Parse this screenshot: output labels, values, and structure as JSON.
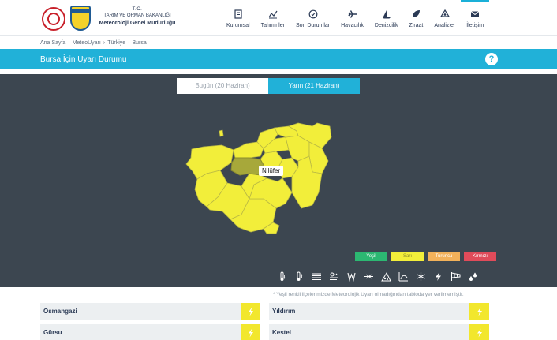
{
  "header": {
    "org_line1": "T.C.",
    "org_line2": "TARIM VE ORMAN BAKANLIĞI",
    "org_line3": "Meteoroloji Genel Müdürlüğü",
    "nav": [
      {
        "label": "Kurumsal",
        "icon": "building-icon"
      },
      {
        "label": "Tahminler",
        "icon": "chart-icon"
      },
      {
        "label": "Son Durumlar",
        "icon": "clock-icon"
      },
      {
        "label": "Havacılık",
        "icon": "plane-icon"
      },
      {
        "label": "Denizcilik",
        "icon": "sailboat-icon"
      },
      {
        "label": "Ziraat",
        "icon": "leaf-icon"
      },
      {
        "label": "Analizler",
        "icon": "analysis-icon"
      },
      {
        "label": "İletişim",
        "icon": "mail-icon"
      }
    ]
  },
  "breadcrumb": [
    "Ana Sayfa",
    "·",
    "MeteoUyarı",
    "›",
    "Türkiye",
    "·",
    "Bursa"
  ],
  "page": {
    "title": "Bursa İçin Uyarı Durumu",
    "help": "?"
  },
  "tabs": [
    {
      "label": "Bugün (20 Haziran)",
      "active": false
    },
    {
      "label": "Yarın (21 Haziran)",
      "active": true
    }
  ],
  "map": {
    "hover_label": "Nilüfer",
    "fill_color": "#f2ee3a",
    "highlight_color": "#a7a83a"
  },
  "legend": [
    {
      "label": "Yeşil",
      "color": "#2cb872"
    },
    {
      "label": "Sarı",
      "color": "#f2ee3a"
    },
    {
      "label": "Turuncu",
      "color": "#f2b15a"
    },
    {
      "label": "Kırmızı",
      "color": "#e04b5a"
    }
  ],
  "hazards": [
    "cold-icon",
    "heat-icon",
    "fog-icon",
    "dust-icon",
    "wind-icon",
    "storm-icon",
    "avalanche-icon",
    "ice-icon",
    "snow-icon",
    "lightning-icon",
    "windsock-icon",
    "rain-icon"
  ],
  "note": "* Yeşil renkli ilçelerimizde Meteorolojik Uyarı olmadığından tabloda yer verilmemiştir.",
  "districts": [
    {
      "name": "Osmangazi",
      "level_color": "#f2e72d"
    },
    {
      "name": "Yıldırım",
      "level_color": "#f2e72d"
    },
    {
      "name": "Gürsu",
      "level_color": "#f2e72d"
    },
    {
      "name": "Kestel",
      "level_color": "#f2e72d"
    }
  ]
}
